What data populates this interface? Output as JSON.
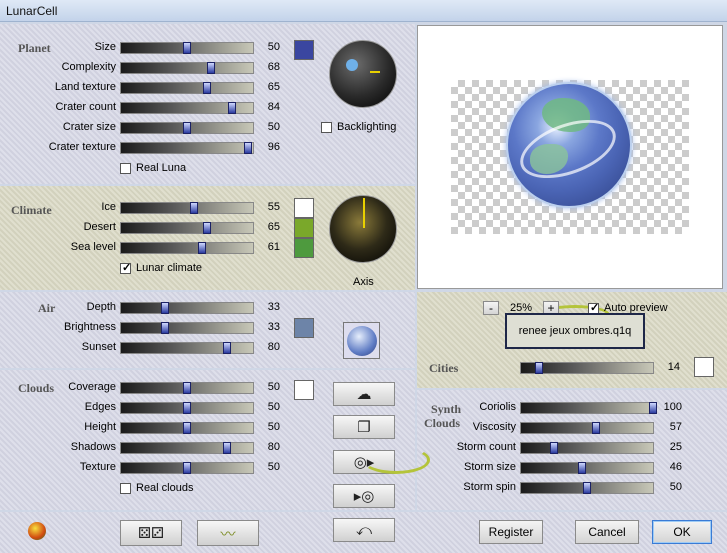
{
  "window": {
    "title": "LunarCell"
  },
  "planet": {
    "section": "Planet",
    "rows": [
      {
        "label": "Size",
        "value": "50",
        "pct": 0.5
      },
      {
        "label": "Complexity",
        "value": "68",
        "pct": 0.68
      },
      {
        "label": "Land texture",
        "value": "65",
        "pct": 0.65
      },
      {
        "label": "Crater count",
        "value": "84",
        "pct": 0.84
      },
      {
        "label": "Crater size",
        "value": "50",
        "pct": 0.5
      },
      {
        "label": "Crater texture",
        "value": "96",
        "pct": 0.96
      }
    ],
    "real_luna": "Real Luna",
    "backlighting": "Backlighting",
    "color": "#3a46a0"
  },
  "climate": {
    "section": "Climate",
    "rows": [
      {
        "label": "Ice",
        "value": "55",
        "pct": 0.55
      },
      {
        "label": "Desert",
        "value": "65",
        "pct": 0.65
      },
      {
        "label": "Sea level",
        "value": "61",
        "pct": 0.61
      }
    ],
    "lunar_climate": "Lunar climate",
    "axis_label": "Axis",
    "colors": [
      "#ffffff",
      "#7aa82a",
      "#4e9a3e"
    ]
  },
  "air": {
    "section": "Air",
    "rows": [
      {
        "label": "Depth",
        "value": "33",
        "pct": 0.33
      },
      {
        "label": "Brightness",
        "value": "33",
        "pct": 0.33
      },
      {
        "label": "Sunset",
        "value": "80",
        "pct": 0.8
      }
    ],
    "color": "#6d84a8"
  },
  "clouds": {
    "section": "Clouds",
    "rows": [
      {
        "label": "Coverage",
        "value": "50",
        "pct": 0.5
      },
      {
        "label": "Edges",
        "value": "50",
        "pct": 0.5
      },
      {
        "label": "Height",
        "value": "50",
        "pct": 0.5
      },
      {
        "label": "Shadows",
        "value": "80",
        "pct": 0.8
      },
      {
        "label": "Texture",
        "value": "50",
        "pct": 0.5
      }
    ],
    "real_clouds": "Real clouds",
    "color": "#ffffff"
  },
  "preview": {
    "minus": "-",
    "zoom": "25%",
    "plus": "+",
    "auto_preview": "Auto preview",
    "filename": "renee jeux ombres.q1q"
  },
  "cities": {
    "section": "Cities",
    "value": "14",
    "pct": 0.14,
    "color": "#ffffff"
  },
  "synth": {
    "section_line1": "Synth",
    "section_line2": "Clouds",
    "rows": [
      {
        "label": "Coriolis",
        "value": "100",
        "pct": 1.0
      },
      {
        "label": "Viscosity",
        "value": "57",
        "pct": 0.57
      },
      {
        "label": "Storm count",
        "value": "25",
        "pct": 0.25
      },
      {
        "label": "Storm size",
        "value": "46",
        "pct": 0.46
      },
      {
        "label": "Storm spin",
        "value": "50",
        "pct": 0.5
      }
    ]
  },
  "buttons": {
    "register": "Register",
    "cancel": "Cancel",
    "ok": "OK"
  },
  "icons": [
    "cloud-icon",
    "copy-icon",
    "disk-load-icon",
    "disk-save-icon",
    "undo-icon",
    "dice-icon",
    "wave-icon",
    "app-logo-icon"
  ]
}
